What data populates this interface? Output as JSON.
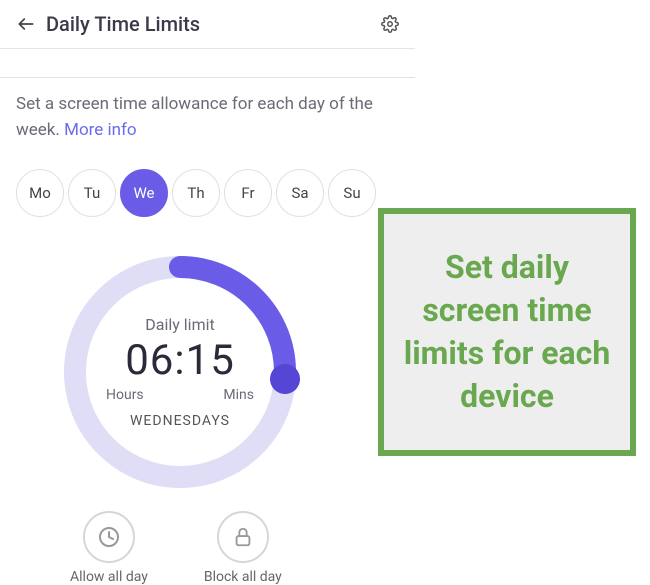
{
  "header": {
    "title": "Daily Time Limits"
  },
  "description": {
    "text": "Set a screen time allowance for each day of the week. ",
    "more_info": "More info"
  },
  "days": {
    "items": [
      "Mo",
      "Tu",
      "We",
      "Th",
      "Fr",
      "Sa",
      "Su"
    ],
    "selected_index": 2
  },
  "dial": {
    "label": "Daily limit",
    "time": "06:15",
    "hours_label": "Hours",
    "mins_label": "Mins",
    "day_name": "WEDNESDAYS",
    "percent": 26
  },
  "actions": {
    "allow": {
      "label": "Allow all day"
    },
    "block": {
      "label": "Block all day"
    }
  },
  "callout": {
    "text": "Set daily screen time limits for each device"
  },
  "colors": {
    "accent": "#6b5ce7",
    "track": "#e0def7",
    "callout_border": "#6aa84f",
    "callout_bg": "#eeeeee"
  }
}
